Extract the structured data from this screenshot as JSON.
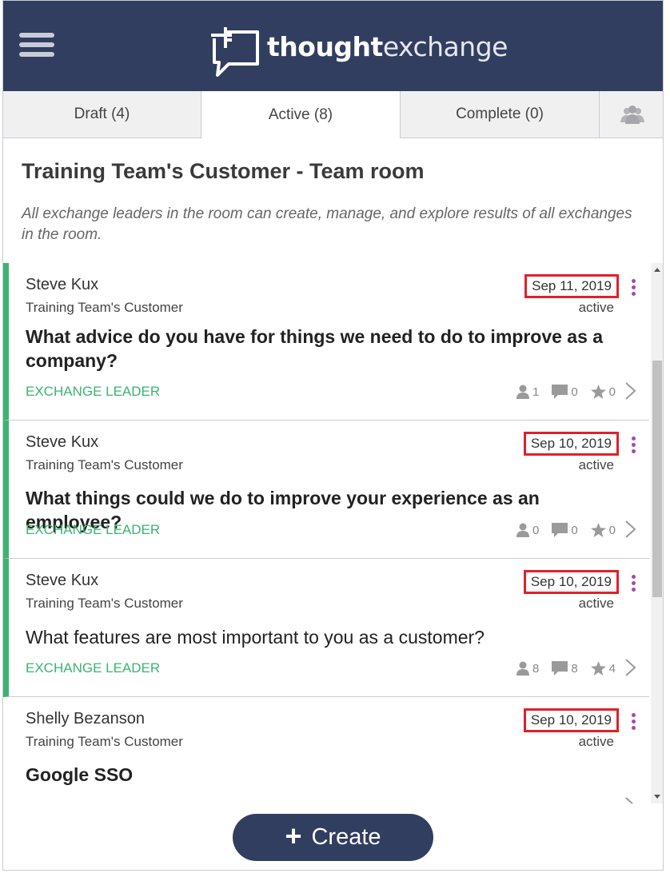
{
  "app": {
    "brand_bold": "thought",
    "brand_light": "exchange"
  },
  "tabs": [
    {
      "label": "Draft (4)"
    },
    {
      "label": "Active (8)"
    },
    {
      "label": "Complete (0)"
    }
  ],
  "room": {
    "title": "Training Team's Customer - Team room",
    "description": "All exchange leaders in the room can create, manage, and explore results of all exchanges in the room."
  },
  "exchanges": [
    {
      "author": "Steve Kux",
      "org": "Training Team's Customer",
      "date": "Sep 11, 2019",
      "status": "active",
      "question": "What advice do you have for things we need to do to improve as a company?",
      "role": "EXCHANGE LEADER",
      "participants": "1",
      "thoughts": "0",
      "stars": "0"
    },
    {
      "author": "Steve Kux",
      "org": "Training Team's Customer",
      "date": "Sep 10, 2019",
      "status": "active",
      "question": "What things could we do to improve your experience as an employee?",
      "role": "EXCHANGE LEADER",
      "participants": "0",
      "thoughts": "0",
      "stars": "0"
    },
    {
      "author": "Steve Kux",
      "org": "Training Team's Customer",
      "date": "Sep 10, 2019",
      "status": "active",
      "question": "What features are most important to you as a customer?",
      "role": "EXCHANGE LEADER",
      "participants": "8",
      "thoughts": "8",
      "stars": "4"
    },
    {
      "author": "Shelly Bezanson",
      "org": "Training Team's Customer",
      "date": "Sep 10, 2019",
      "status": "active",
      "question": "Google SSO"
    }
  ],
  "create_button": {
    "label": "Create"
  },
  "colors": {
    "header": "#323e60",
    "leader_green": "#3cb371",
    "highlight_red": "#e0212b",
    "menu_purple": "#a14ab0"
  }
}
